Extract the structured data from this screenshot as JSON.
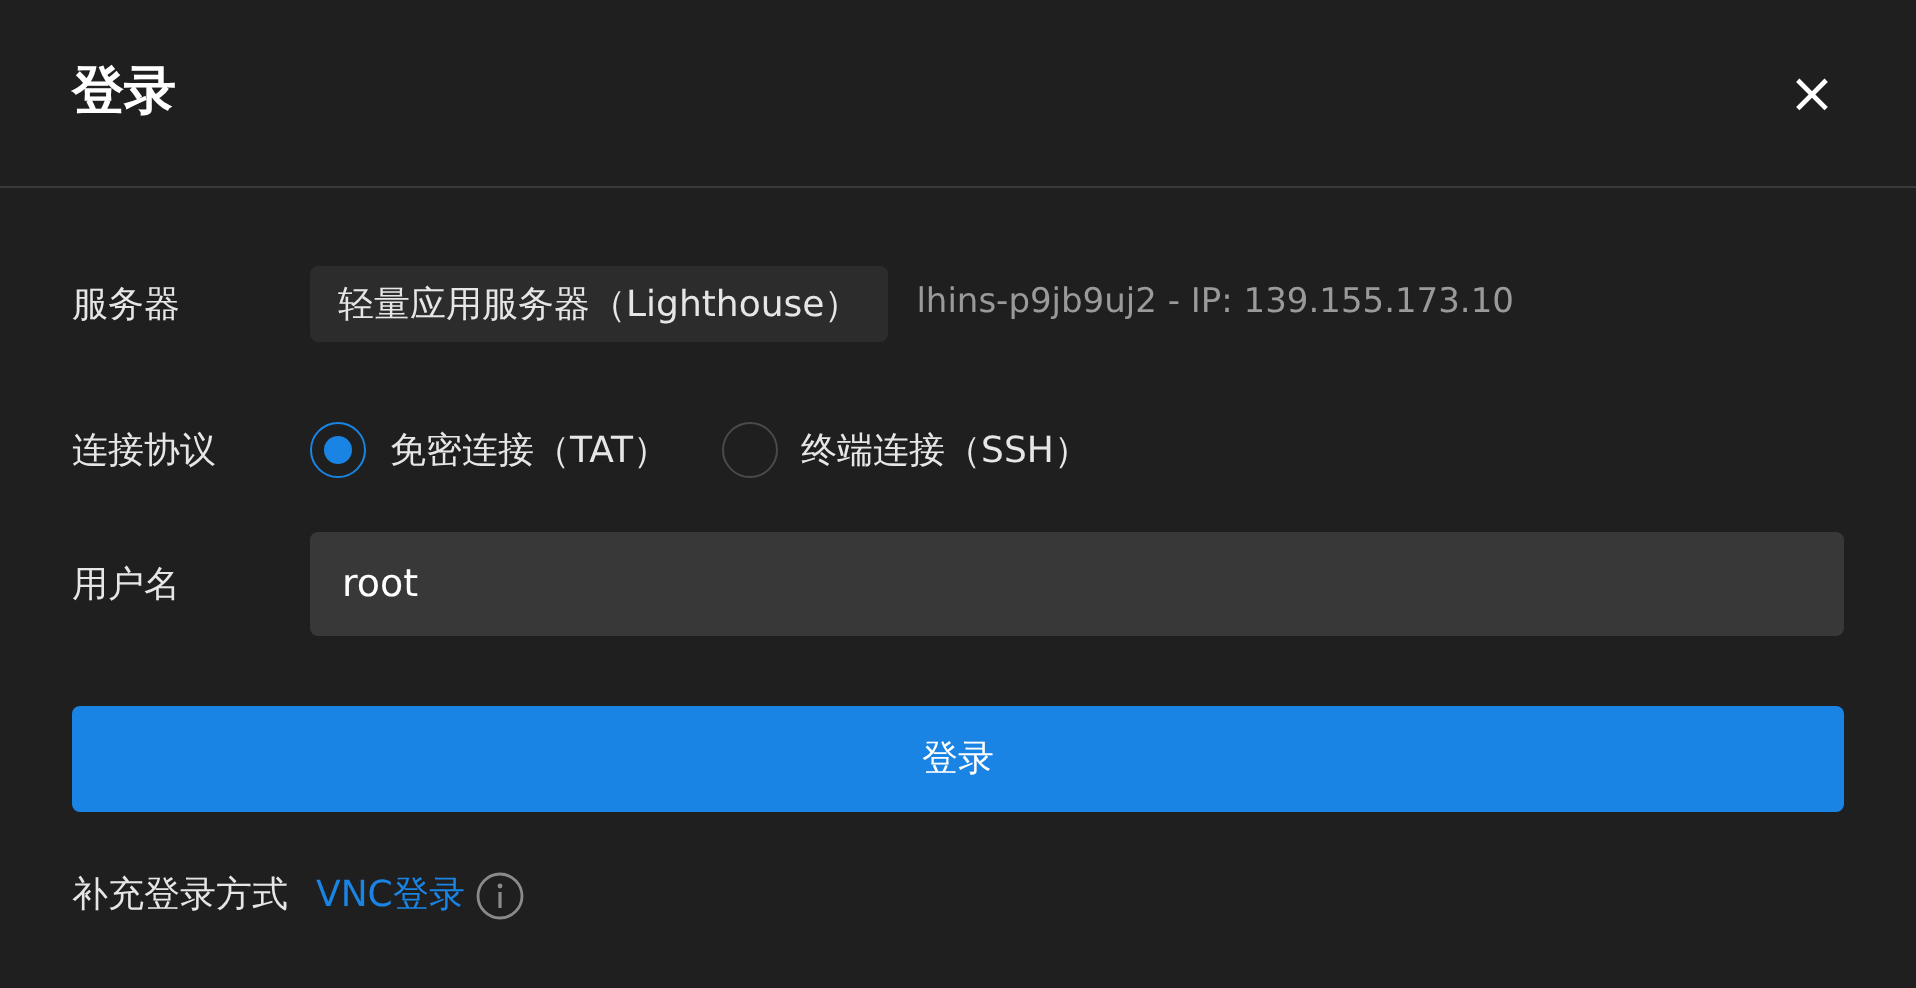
{
  "dialog": {
    "title": "登录",
    "close": "×"
  },
  "server": {
    "label": "服务器",
    "value": "轻量应用服务器（Lighthouse）",
    "detail": "lhins-p9jb9uj2 - IP: 139.155.173.10"
  },
  "protocol": {
    "label": "连接协议",
    "options": [
      {
        "label": "免密连接（TAT）",
        "selected": true
      },
      {
        "label": "终端连接（SSH）",
        "selected": false
      }
    ]
  },
  "username": {
    "label": "用户名",
    "value": "root"
  },
  "submit": "登录",
  "alternative": {
    "label": "补充登录方式",
    "link": "VNC登录"
  }
}
